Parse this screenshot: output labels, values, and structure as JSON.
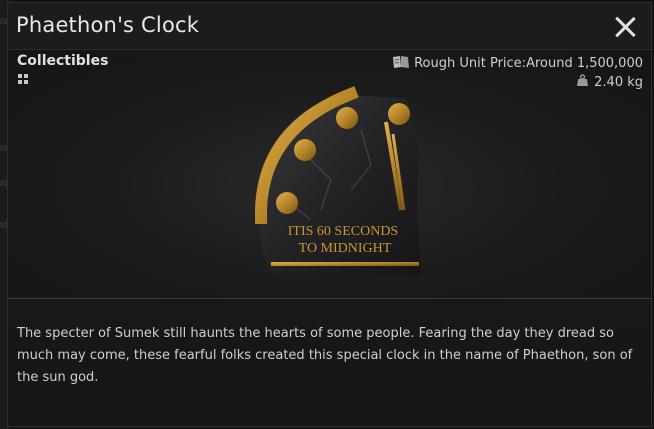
{
  "window": {
    "title": "Phaethon's Clock",
    "close_icon": "close-icon"
  },
  "item": {
    "category": "Collectibles",
    "price_label": "Rough Unit Price:Around 1,500,000",
    "weight": "2.40 kg",
    "image_caption_line1": "ITIS 60 SECONDS",
    "image_caption_line2": "TO MIDNIGHT",
    "description": "The specter of Sumek still haunts the hearts of some people. Fearing the day they dread so much may come, these fearful folks created this special clock in the name of Phaethon, son of the sun god."
  },
  "icons": {
    "category": "grid-icon",
    "price": "book-icon",
    "weight": "weight-icon"
  },
  "colors": {
    "gold": "#c8972e",
    "text": "#cfcfcf"
  }
}
